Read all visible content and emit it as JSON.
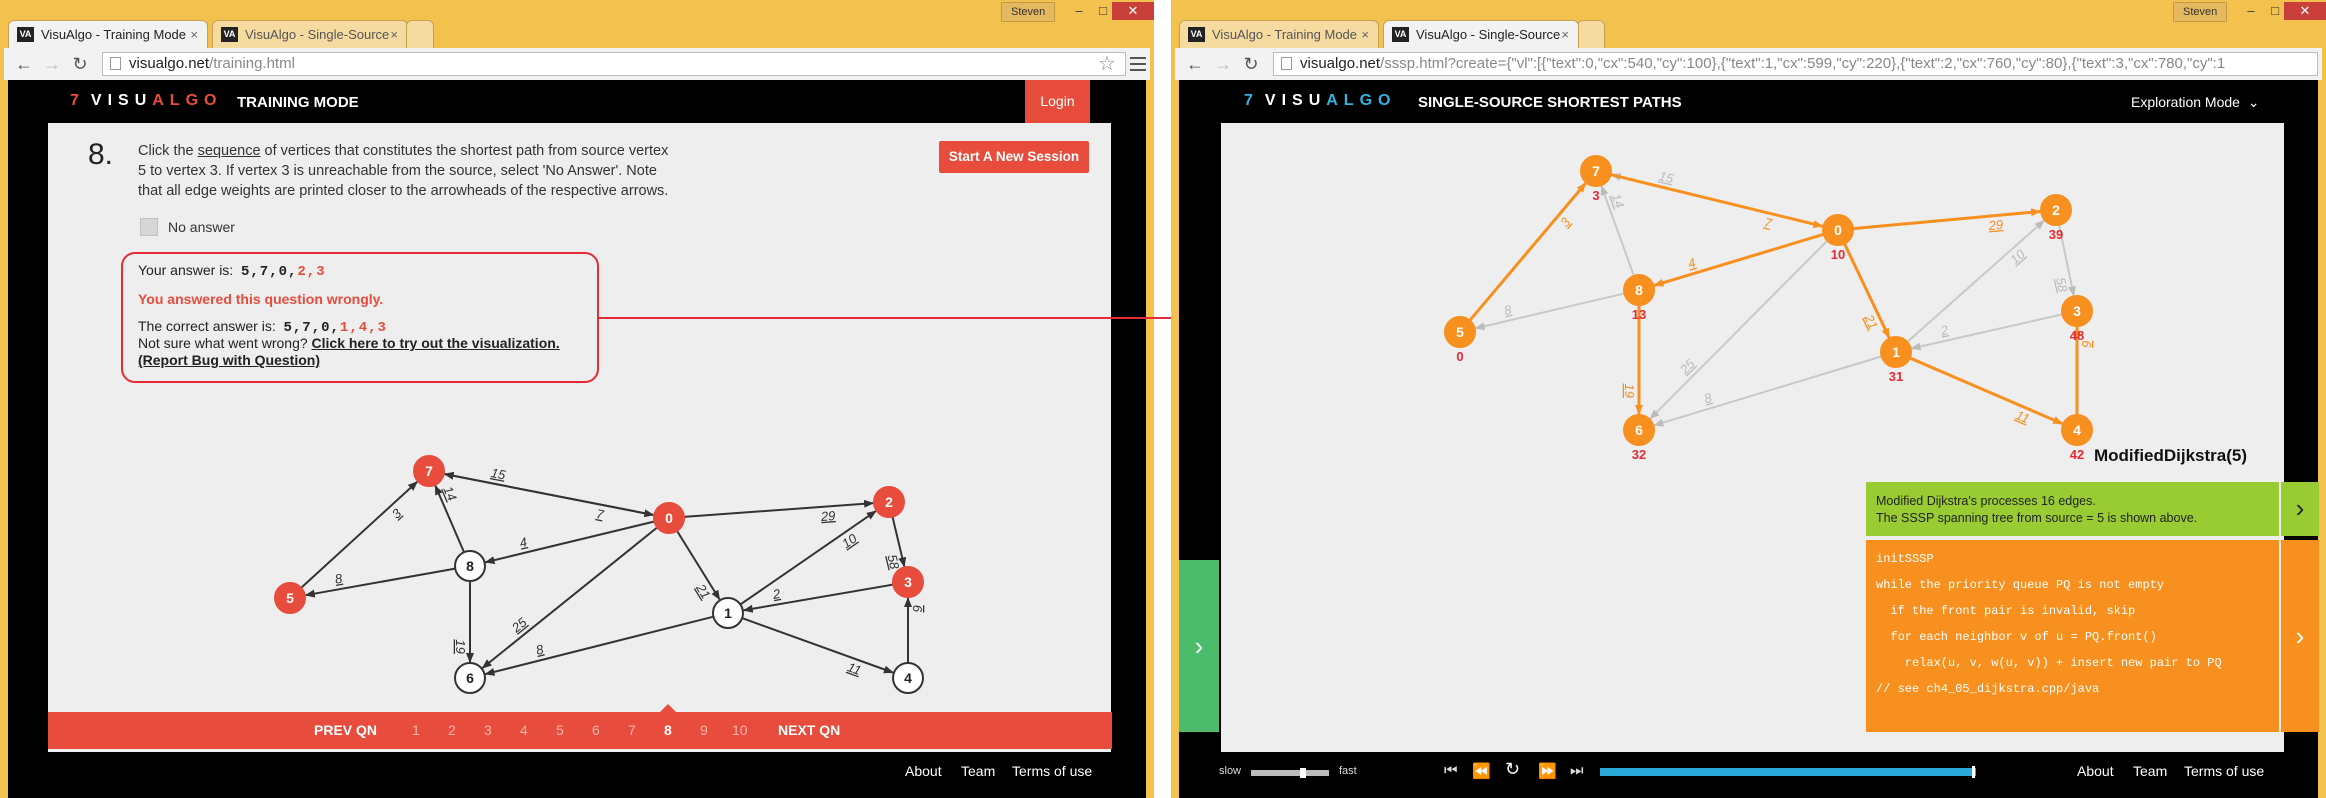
{
  "left": {
    "tabs": [
      {
        "label": "VisuAlgo - Training Mode",
        "active": true
      },
      {
        "label": "VisuAlgo - Single-Source",
        "active": false
      }
    ],
    "user": "Steven",
    "url": {
      "host": "visualgo.net",
      "path": "/training.html"
    },
    "header": {
      "logo_num": "7",
      "logo_visu": "VISU",
      "logo_algo": "ALGO",
      "title": "TRAINING MODE",
      "login": "Login"
    },
    "question": {
      "number": "8.",
      "text_pre": "Click the ",
      "text_link": "sequence",
      "text_post": " of vertices that constitutes the shortest path from source vertex 5 to vertex 3. If vertex 3 is unreachable from the source, select 'No Answer'. Note that all edge weights are printed closer to the arrowheads of the respective arrows.",
      "start_button": "Start A New Session",
      "no_answer": "No answer"
    },
    "feedback": {
      "your_answer_label": "Your answer is:",
      "your_answer_a": "5,7,0,",
      "your_answer_b": "2,3",
      "wrong_msg": "You answered this question wrongly.",
      "correct_label": "The correct answer is:",
      "correct_a": "5,7,0,",
      "correct_b": "1,4,3",
      "not_sure": "Not sure what went wrong? ",
      "try_link": "Click here to try out the visualization.",
      "report_link": "(Report Bug with Question)"
    },
    "graph": {
      "vertices": [
        {
          "id": "7",
          "state": "red"
        },
        {
          "id": "0",
          "state": "red"
        },
        {
          "id": "2",
          "state": "red"
        },
        {
          "id": "3",
          "state": "red"
        },
        {
          "id": "5",
          "state": "red"
        },
        {
          "id": "8",
          "state": "white"
        },
        {
          "id": "1",
          "state": "white"
        },
        {
          "id": "6",
          "state": "white"
        },
        {
          "id": "4",
          "state": "white"
        }
      ],
      "edges": [
        {
          "from": "5",
          "to": "7",
          "w": "3"
        },
        {
          "from": "8",
          "to": "7",
          "w": "14"
        },
        {
          "from": "0",
          "to": "7",
          "w": "15"
        },
        {
          "from": "7",
          "to": "0",
          "w": "7"
        },
        {
          "from": "0",
          "to": "2",
          "w": "29"
        },
        {
          "from": "1",
          "to": "2",
          "w": "10"
        },
        {
          "from": "2",
          "to": "3",
          "w": "58"
        },
        {
          "from": "0",
          "to": "8",
          "w": "4"
        },
        {
          "from": "0",
          "to": "1",
          "w": "21"
        },
        {
          "from": "3",
          "to": "1",
          "w": "2"
        },
        {
          "from": "4",
          "to": "3",
          "w": "9"
        },
        {
          "from": "8",
          "to": "5",
          "w": "8"
        },
        {
          "from": "8",
          "to": "6",
          "w": "19"
        },
        {
          "from": "0",
          "to": "6",
          "w": "25"
        },
        {
          "from": "1",
          "to": "6",
          "w": "8"
        },
        {
          "from": "1",
          "to": "4",
          "w": "11"
        }
      ]
    },
    "qnav": {
      "prev": "PREV QN",
      "next": "NEXT QN",
      "items": [
        "1",
        "2",
        "3",
        "4",
        "5",
        "6",
        "7",
        "8",
        "9",
        "10"
      ],
      "current": "8"
    },
    "footer": [
      "About",
      "Team",
      "Terms of use"
    ]
  },
  "right": {
    "tabs": [
      {
        "label": "VisuAlgo - Training Mode",
        "active": false
      },
      {
        "label": "VisuAlgo - Single-Source",
        "active": true
      }
    ],
    "user": "Steven",
    "url": {
      "host": "visualgo.net",
      "rest": "/sssp.html?create={\"vl\":[{\"text\":0,\"cx\":540,\"cy\":100},{\"text\":1,\"cx\":599,\"cy\":220},{\"text\":2,\"cx\":760,\"cy\":80},{\"text\":3,\"cx\":780,\"cy\":1"
    },
    "header": {
      "logo_num": "7",
      "logo_visu": "VISU",
      "logo_algo": "ALGO",
      "title": "SINGLE-SOURCE SHORTEST PATHS",
      "mode": "Exploration Mode"
    },
    "graph": {
      "vertices": [
        {
          "id": "7",
          "dist": "3"
        },
        {
          "id": "0",
          "dist": "10"
        },
        {
          "id": "2",
          "dist": "39"
        },
        {
          "id": "3",
          "dist": "48"
        },
        {
          "id": "5",
          "dist": "0"
        },
        {
          "id": "8",
          "dist": "13"
        },
        {
          "id": "1",
          "dist": "31"
        },
        {
          "id": "6",
          "dist": "32"
        },
        {
          "id": "4",
          "dist": "42"
        }
      ],
      "edges": [
        {
          "from": "5",
          "to": "7",
          "w": "3",
          "tree": true
        },
        {
          "from": "8",
          "to": "7",
          "w": "14",
          "tree": false
        },
        {
          "from": "0",
          "to": "7",
          "w": "15",
          "tree": false
        },
        {
          "from": "7",
          "to": "0",
          "w": "7",
          "tree": true
        },
        {
          "from": "0",
          "to": "2",
          "w": "29",
          "tree": true
        },
        {
          "from": "1",
          "to": "2",
          "w": "10",
          "tree": false
        },
        {
          "from": "2",
          "to": "3",
          "w": "58",
          "tree": false
        },
        {
          "from": "0",
          "to": "8",
          "w": "4",
          "tree": true
        },
        {
          "from": "0",
          "to": "1",
          "w": "21",
          "tree": true
        },
        {
          "from": "3",
          "to": "1",
          "w": "2",
          "tree": false
        },
        {
          "from": "4",
          "to": "3",
          "w": "9",
          "tree": true
        },
        {
          "from": "8",
          "to": "5",
          "w": "8",
          "tree": false
        },
        {
          "from": "8",
          "to": "6",
          "w": "19",
          "tree": true
        },
        {
          "from": "0",
          "to": "6",
          "w": "25",
          "tree": false
        },
        {
          "from": "1",
          "to": "6",
          "w": "8",
          "tree": false
        },
        {
          "from": "1",
          "to": "4",
          "w": "11",
          "tree": true
        }
      ]
    },
    "algo_title": "ModifiedDijkstra(5)",
    "status": {
      "line1": "Modified Dijkstra's processes 16 edges.",
      "line2": "The SSSP spanning tree from source = 5 is shown above."
    },
    "code": [
      "initSSSP",
      "while the priority queue PQ is not empty",
      "  if the front pair is invalid, skip",
      "  for each neighbor v of u = PQ.front()",
      "    relax(u, v, w(u, v)) + insert new pair to PQ",
      "// see ch4_05_dijkstra.cpp/java"
    ],
    "speed": {
      "slow": "slow",
      "fast": "fast"
    },
    "footer": [
      "About",
      "Team",
      "Terms of use"
    ]
  },
  "colors": {
    "accent_red": "#e74c3c",
    "orange": "#f7901e",
    "green": "#99cc33",
    "teal": "#34b3dc",
    "window_frame": "#f2c14e"
  }
}
